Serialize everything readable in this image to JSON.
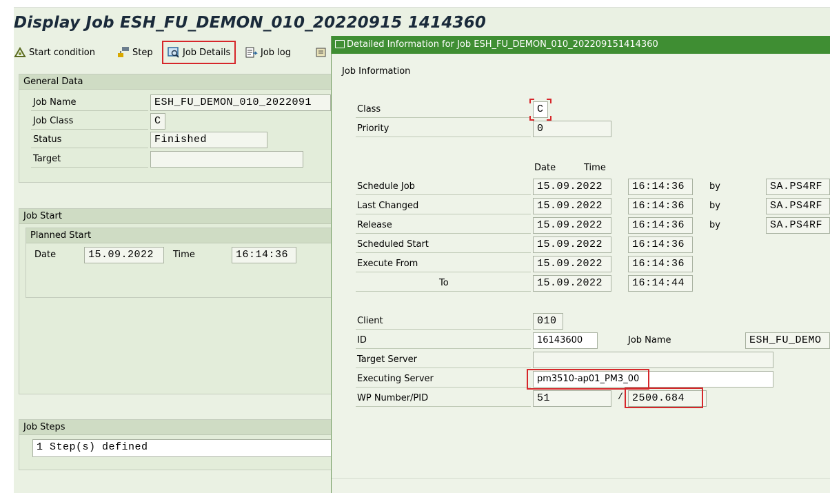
{
  "main": {
    "title": "Display Job ESH_FU_DEMON_010_20220915 1414360",
    "toolbar": {
      "start_condition": "Start condition",
      "step": "Step",
      "job_details": "Job Details",
      "job_log": "Job log"
    },
    "general_data": {
      "header": "General Data",
      "job_name_label": "Job Name",
      "job_name_value": "ESH_FU_DEMON_010_2022091",
      "job_class_label": "Job Class",
      "job_class_value": "C",
      "status_label": "Status",
      "status_value": "Finished",
      "target_label": "Target",
      "target_value": ""
    },
    "job_start": {
      "header": "Job Start",
      "planned_start_header": "Planned Start",
      "date_label": "Date",
      "date_value": "15.09.2022",
      "time_label": "Time",
      "time_value": "16:14:36"
    },
    "job_steps": {
      "header": "Job Steps",
      "value": "1 Step(s) defined"
    }
  },
  "dialog": {
    "title": "Detailed Information for Job ESH_FU_DEMON_010_202209151414360",
    "section_label": "Job Information",
    "class_label": "Class",
    "class_value": "C",
    "priority_label": "Priority",
    "priority_value": "0",
    "col_date": "Date",
    "col_time": "Time",
    "rows": [
      {
        "label": "Schedule Job",
        "date": "15.09.2022",
        "time": "16:14:36",
        "by": "by",
        "user": "SA.PS4RF"
      },
      {
        "label": "Last Changed",
        "date": "15.09.2022",
        "time": "16:14:36",
        "by": "by",
        "user": "SA.PS4RF"
      },
      {
        "label": "Release",
        "date": "15.09.2022",
        "time": "16:14:36",
        "by": "by",
        "user": "SA.PS4RF"
      },
      {
        "label": "Scheduled Start",
        "date": "15.09.2022",
        "time": "16:14:36"
      },
      {
        "label": "Execute From",
        "date": "15.09.2022",
        "time": "16:14:36"
      },
      {
        "label": "To",
        "date": "15.09.2022",
        "time": "16:14:44"
      }
    ],
    "client_label": "Client",
    "client_value": "010",
    "id_label": "ID",
    "id_value": "16143600",
    "job_name_label": "Job Name",
    "job_name_value": "ESH_FU_DEMO",
    "target_server_label": "Target Server",
    "target_server_value": "",
    "executing_server_label": "Executing Server",
    "executing_server_value": "pm3510-ap01_PM3_00",
    "wp_label": "WP Number/PID",
    "wp_value": "51",
    "pid_sep": "/",
    "pid_value": "2500.684"
  },
  "colors": {
    "dialog_title_bg": "#3f8e33",
    "highlight": "#d6262a",
    "panel_bg": "#e3edda"
  }
}
